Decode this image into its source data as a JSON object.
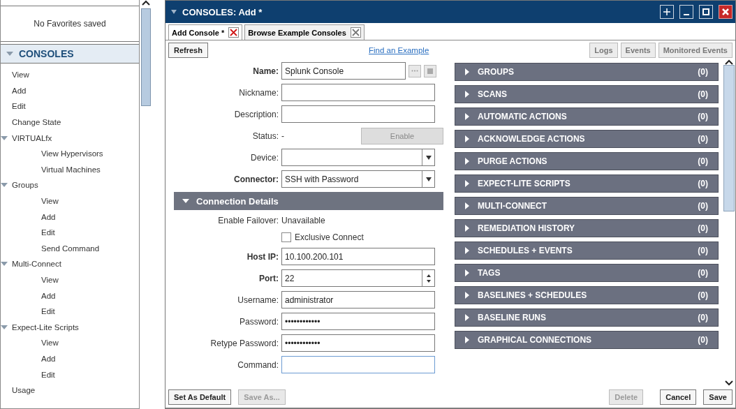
{
  "sidebar": {
    "favorites_empty": "No Favorites saved",
    "section": {
      "label": "CONSOLES",
      "expanded": true
    },
    "items": [
      {
        "label": "View"
      },
      {
        "label": "Add"
      },
      {
        "label": "Edit"
      },
      {
        "label": "Change State"
      },
      {
        "label": "VIRTUALfx",
        "expanded": true,
        "children": [
          {
            "label": "View Hypervisors"
          },
          {
            "label": "Virtual Machines"
          }
        ]
      },
      {
        "label": "Groups",
        "expanded": true,
        "children": [
          {
            "label": "View"
          },
          {
            "label": "Add"
          },
          {
            "label": "Edit"
          },
          {
            "label": "Send Command"
          }
        ]
      },
      {
        "label": "Multi-Connect",
        "expanded": true,
        "children": [
          {
            "label": "View"
          },
          {
            "label": "Add"
          },
          {
            "label": "Edit"
          }
        ]
      },
      {
        "label": "Expect-Lite Scripts",
        "expanded": true,
        "children": [
          {
            "label": "View"
          },
          {
            "label": "Add"
          },
          {
            "label": "Edit"
          }
        ]
      },
      {
        "label": "Usage"
      }
    ]
  },
  "window": {
    "title": "CONSOLES: Add *",
    "tabs": [
      {
        "label": "Add Console *",
        "selected": true
      },
      {
        "label": "Browse Example Consoles",
        "selected": false
      }
    ],
    "toolbar": {
      "refresh": "Refresh",
      "link": "Find an Example",
      "buttons": [
        "Logs",
        "Events",
        "Monitored Events"
      ]
    },
    "form": [
      {
        "kind": "text",
        "label": "Name:",
        "value": "Splunk Console",
        "required": true,
        "extras": true
      },
      {
        "kind": "text",
        "label": "Nickname:",
        "required": false
      },
      {
        "kind": "text",
        "label": "Description:",
        "required": false
      },
      {
        "kind": "status",
        "label": "Status:",
        "state_text": "-",
        "button": "Enable"
      },
      {
        "kind": "select",
        "label": "Device:",
        "required": false
      },
      {
        "kind": "select",
        "label": "Connector:",
        "value": "SSH with Password",
        "required": true
      },
      {
        "kind": "header",
        "label": "Connection Details",
        "expanded": true
      },
      {
        "kind": "info",
        "label": "Enable Failover:",
        "value": "Unavailable"
      },
      {
        "kind": "checkbox",
        "label": "Exclusive Connect",
        "checked": false
      },
      {
        "kind": "text",
        "label": "Host IP:",
        "value": "10.100.200.101",
        "required": true
      },
      {
        "kind": "spinner",
        "label": "Port:",
        "value": "22",
        "required": true
      },
      {
        "kind": "text",
        "label": "Username:",
        "value": "administrator",
        "required": false
      },
      {
        "kind": "text",
        "label": "Password:",
        "value": "••••••••••••",
        "required": false
      },
      {
        "kind": "text",
        "label": "Retype Password:",
        "value": "••••••••••••",
        "required": false
      },
      {
        "kind": "text",
        "label": "Command:",
        "required": false,
        "focused": true
      }
    ],
    "sections": [
      {
        "label": "GROUPS",
        "count": "(0)"
      },
      {
        "label": "SCANS",
        "count": "(0)"
      },
      {
        "label": "AUTOMATIC ACTIONS",
        "count": "(0)"
      },
      {
        "label": "ACKNOWLEDGE ACTIONS",
        "count": "(0)"
      },
      {
        "label": "PURGE ACTIONS",
        "count": "(0)"
      },
      {
        "label": "EXPECT-LITE SCRIPTS",
        "count": "(0)"
      },
      {
        "label": "MULTI-CONNECT",
        "count": "(0)"
      },
      {
        "label": "REMEDIATION HISTORY",
        "count": "(0)"
      },
      {
        "label": "SCHEDULES + EVENTS",
        "count": "(0)"
      },
      {
        "label": "TAGS",
        "count": "(0)"
      },
      {
        "label": "BASELINES + SCHEDULES",
        "count": "(0)"
      },
      {
        "label": "BASELINE RUNS",
        "count": "(0)"
      },
      {
        "label": "GRAPHICAL CONNECTIONS",
        "count": "(0)"
      }
    ],
    "footer": {
      "left": [
        {
          "label": "Set As Default",
          "disabled": false
        },
        {
          "label": "Save As...",
          "disabled": true
        }
      ],
      "right": [
        {
          "label": "Delete",
          "disabled": true
        },
        {
          "label": "Cancel",
          "disabled": false
        },
        {
          "label": "Save",
          "disabled": false
        }
      ]
    }
  }
}
